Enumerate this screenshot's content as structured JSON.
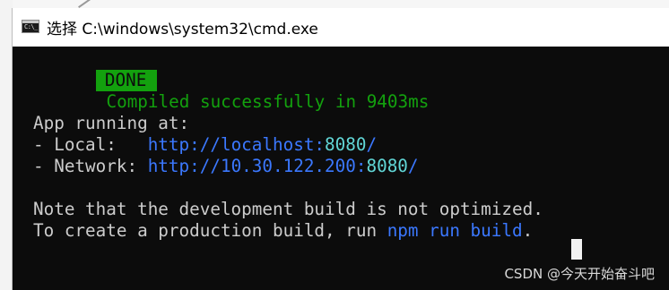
{
  "window": {
    "title": "选择 C:\\windows\\system32\\cmd.exe",
    "icon_text": "C:\\_"
  },
  "terminal": {
    "done_badge": "DONE",
    "compiled_message": "Compiled successfully in 9403ms",
    "app_running": "App running at:",
    "local_label": "- Local:   ",
    "local_url_base": "http://localhost:",
    "local_port": "8080",
    "local_slash": "/",
    "network_label": "- Network: ",
    "network_url_base": "http://10.30.122.200:",
    "network_port": "8080",
    "network_slash": "/",
    "note_line": "Note that the development build is not optimized.",
    "prod_prefix": "To create a production build, run ",
    "prod_command": "npm run build",
    "prod_suffix": "."
  },
  "watermark": "CSDN @今天开始奋斗吧",
  "colors": {
    "terminal_bg": "#0c0c0c",
    "terminal_fg": "#cccccc",
    "done_green": "#13a10e",
    "url_blue": "#3b78ff",
    "port_cyan": "#61d6d6"
  }
}
